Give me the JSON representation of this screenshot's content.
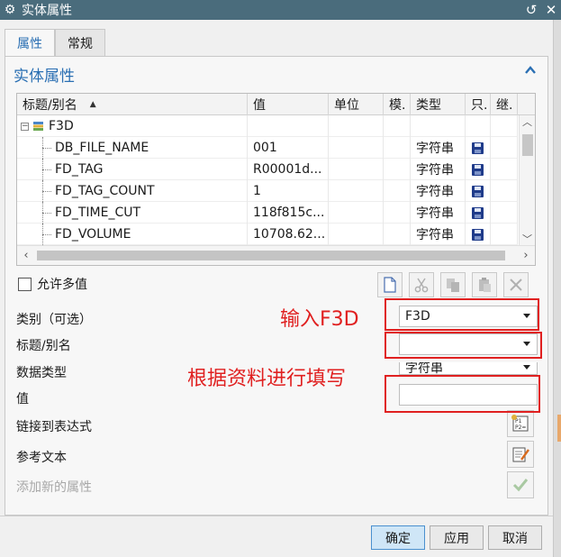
{
  "window": {
    "title": "实体属性",
    "icon": "gear-icon",
    "buttons": [
      "reset-icon",
      "close-icon"
    ]
  },
  "tabs": [
    {
      "label": "属性",
      "active": true
    },
    {
      "label": "常规",
      "active": false
    }
  ],
  "section": {
    "title": "实体属性",
    "collapse_icon": "chevron-up-icon"
  },
  "table": {
    "columns": [
      "标题/别名",
      "值",
      "单位",
      "模.",
      "类型",
      "只.",
      "继."
    ],
    "sort_indicator": "sort-ascending-icon",
    "root": {
      "label": "F3D",
      "icon": "stack-icon",
      "expanded": true
    },
    "rows": [
      {
        "name": "DB_FILE_NAME",
        "value": "001",
        "unit": "",
        "mod": "",
        "type": "字符串",
        "readonly_icon": "save-icon",
        "inherit": ""
      },
      {
        "name": "FD_TAG",
        "value": "R00001d...",
        "unit": "",
        "mod": "",
        "type": "字符串",
        "readonly_icon": "save-icon",
        "inherit": ""
      },
      {
        "name": "FD_TAG_COUNT",
        "value": "1",
        "unit": "",
        "mod": "",
        "type": "字符串",
        "readonly_icon": "save-icon",
        "inherit": ""
      },
      {
        "name": "FD_TIME_CUT",
        "value": "118f815c...",
        "unit": "",
        "mod": "",
        "type": "字符串",
        "readonly_icon": "save-icon",
        "inherit": ""
      },
      {
        "name": "FD_VOLUME",
        "value": "10708.62...",
        "unit": "",
        "mod": "",
        "type": "字符串",
        "readonly_icon": "save-icon",
        "inherit": ""
      }
    ]
  },
  "options": {
    "allow_multiple_label": "允许多值",
    "allow_multiple_checked": false
  },
  "toolbar": [
    "new-document-icon",
    "cut-icon",
    "copy-icon",
    "paste-icon",
    "delete-icon"
  ],
  "form": {
    "category_label": "类别（可选）",
    "category_value": "F3D",
    "title_label": "标题/别名",
    "title_value": "",
    "datatype_label": "数据类型",
    "datatype_value": "字符串",
    "value_label": "值",
    "value_value": "",
    "link_label": "链接到表达式",
    "ref_text_label": "参考文本",
    "add_new_label": "添加新的属性"
  },
  "annotations": {
    "input_f3d": "输入F3D",
    "fill_by_data": "根据资料进行填写",
    "color": "#e02020"
  },
  "footer": {
    "ok": "确定",
    "apply": "应用",
    "cancel": "取消"
  }
}
